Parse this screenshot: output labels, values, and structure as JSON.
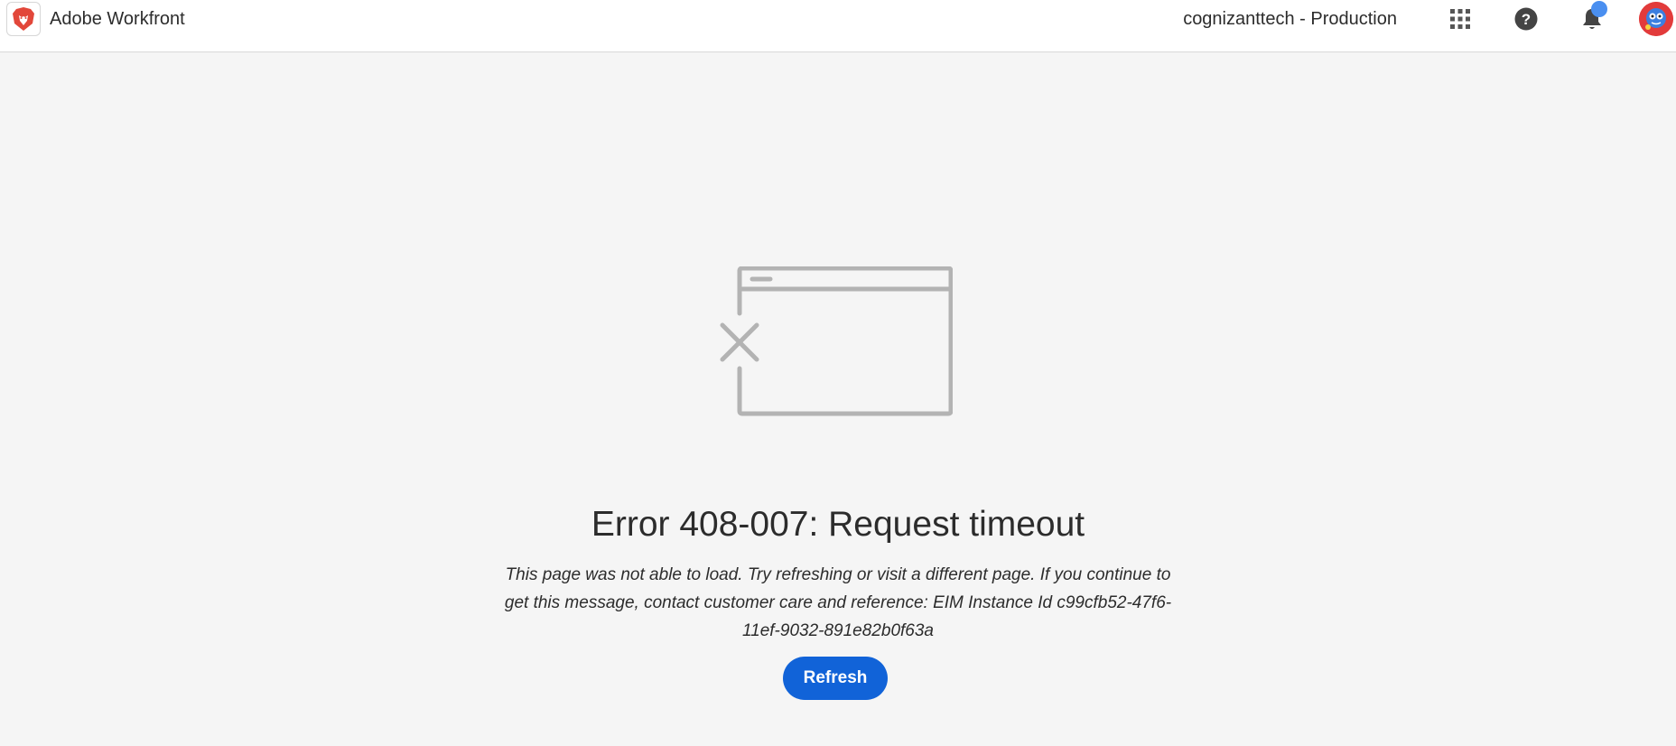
{
  "header": {
    "app_name": "Adobe Workfront",
    "instance_name": "cognizanttech - Production",
    "icons": {
      "logo": "brave-lion-logo-icon",
      "apps": "apps-grid-icon",
      "help": "help-icon",
      "notifications": "notification-bell-icon",
      "avatar": "user-avatar"
    },
    "has_unread_notifications": true
  },
  "error": {
    "title": "Error 408-007: Request timeout",
    "message": "This page was not able to load. Try refreshing or visit a different page. If you continue to get this message, contact customer care and reference: EIM Instance Id c99cfb52-47f6-11ef-9032-891e82b0f63a",
    "refresh_label": "Refresh",
    "illustration": "broken-window-icon"
  },
  "colors": {
    "accent": "#1163d8",
    "background": "#f5f5f5",
    "illustration": "#b3b3b3",
    "notification_dot": "#4a8ff0",
    "avatar": "#e23b3b"
  }
}
